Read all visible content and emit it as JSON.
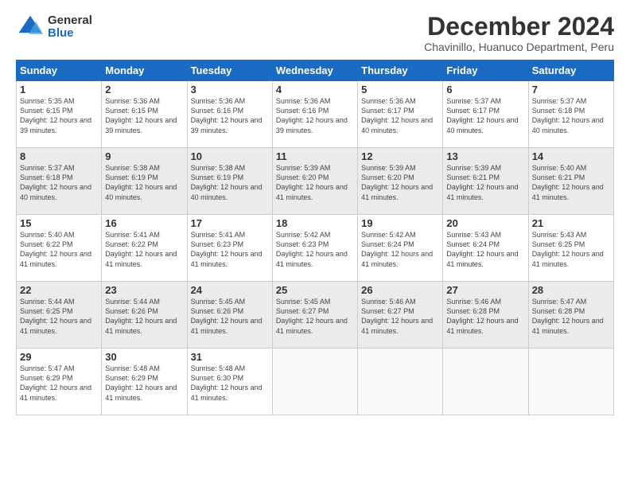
{
  "logo": {
    "general": "General",
    "blue": "Blue"
  },
  "header": {
    "month": "December 2024",
    "location": "Chavinillo, Huanuco Department, Peru"
  },
  "weekdays": [
    "Sunday",
    "Monday",
    "Tuesday",
    "Wednesday",
    "Thursday",
    "Friday",
    "Saturday"
  ],
  "rows": [
    [
      {
        "day": "1",
        "sunrise": "5:35 AM",
        "sunset": "6:15 PM",
        "daylight": "12 hours and 39 minutes."
      },
      {
        "day": "2",
        "sunrise": "5:36 AM",
        "sunset": "6:15 PM",
        "daylight": "12 hours and 39 minutes."
      },
      {
        "day": "3",
        "sunrise": "5:36 AM",
        "sunset": "6:16 PM",
        "daylight": "12 hours and 39 minutes."
      },
      {
        "day": "4",
        "sunrise": "5:36 AM",
        "sunset": "6:16 PM",
        "daylight": "12 hours and 39 minutes."
      },
      {
        "day": "5",
        "sunrise": "5:36 AM",
        "sunset": "6:17 PM",
        "daylight": "12 hours and 40 minutes."
      },
      {
        "day": "6",
        "sunrise": "5:37 AM",
        "sunset": "6:17 PM",
        "daylight": "12 hours and 40 minutes."
      },
      {
        "day": "7",
        "sunrise": "5:37 AM",
        "sunset": "6:18 PM",
        "daylight": "12 hours and 40 minutes."
      }
    ],
    [
      {
        "day": "8",
        "sunrise": "5:37 AM",
        "sunset": "6:18 PM",
        "daylight": "12 hours and 40 minutes."
      },
      {
        "day": "9",
        "sunrise": "5:38 AM",
        "sunset": "6:19 PM",
        "daylight": "12 hours and 40 minutes."
      },
      {
        "day": "10",
        "sunrise": "5:38 AM",
        "sunset": "6:19 PM",
        "daylight": "12 hours and 40 minutes."
      },
      {
        "day": "11",
        "sunrise": "5:39 AM",
        "sunset": "6:20 PM",
        "daylight": "12 hours and 41 minutes."
      },
      {
        "day": "12",
        "sunrise": "5:39 AM",
        "sunset": "6:20 PM",
        "daylight": "12 hours and 41 minutes."
      },
      {
        "day": "13",
        "sunrise": "5:39 AM",
        "sunset": "6:21 PM",
        "daylight": "12 hours and 41 minutes."
      },
      {
        "day": "14",
        "sunrise": "5:40 AM",
        "sunset": "6:21 PM",
        "daylight": "12 hours and 41 minutes."
      }
    ],
    [
      {
        "day": "15",
        "sunrise": "5:40 AM",
        "sunset": "6:22 PM",
        "daylight": "12 hours and 41 minutes."
      },
      {
        "day": "16",
        "sunrise": "5:41 AM",
        "sunset": "6:22 PM",
        "daylight": "12 hours and 41 minutes."
      },
      {
        "day": "17",
        "sunrise": "5:41 AM",
        "sunset": "6:23 PM",
        "daylight": "12 hours and 41 minutes."
      },
      {
        "day": "18",
        "sunrise": "5:42 AM",
        "sunset": "6:23 PM",
        "daylight": "12 hours and 41 minutes."
      },
      {
        "day": "19",
        "sunrise": "5:42 AM",
        "sunset": "6:24 PM",
        "daylight": "12 hours and 41 minutes."
      },
      {
        "day": "20",
        "sunrise": "5:43 AM",
        "sunset": "6:24 PM",
        "daylight": "12 hours and 41 minutes."
      },
      {
        "day": "21",
        "sunrise": "5:43 AM",
        "sunset": "6:25 PM",
        "daylight": "12 hours and 41 minutes."
      }
    ],
    [
      {
        "day": "22",
        "sunrise": "5:44 AM",
        "sunset": "6:25 PM",
        "daylight": "12 hours and 41 minutes."
      },
      {
        "day": "23",
        "sunrise": "5:44 AM",
        "sunset": "6:26 PM",
        "daylight": "12 hours and 41 minutes."
      },
      {
        "day": "24",
        "sunrise": "5:45 AM",
        "sunset": "6:26 PM",
        "daylight": "12 hours and 41 minutes."
      },
      {
        "day": "25",
        "sunrise": "5:45 AM",
        "sunset": "6:27 PM",
        "daylight": "12 hours and 41 minutes."
      },
      {
        "day": "26",
        "sunrise": "5:46 AM",
        "sunset": "6:27 PM",
        "daylight": "12 hours and 41 minutes."
      },
      {
        "day": "27",
        "sunrise": "5:46 AM",
        "sunset": "6:28 PM",
        "daylight": "12 hours and 41 minutes."
      },
      {
        "day": "28",
        "sunrise": "5:47 AM",
        "sunset": "6:28 PM",
        "daylight": "12 hours and 41 minutes."
      }
    ],
    [
      {
        "day": "29",
        "sunrise": "5:47 AM",
        "sunset": "6:29 PM",
        "daylight": "12 hours and 41 minutes."
      },
      {
        "day": "30",
        "sunrise": "5:48 AM",
        "sunset": "6:29 PM",
        "daylight": "12 hours and 41 minutes."
      },
      {
        "day": "31",
        "sunrise": "5:48 AM",
        "sunset": "6:30 PM",
        "daylight": "12 hours and 41 minutes."
      },
      null,
      null,
      null,
      null
    ]
  ]
}
